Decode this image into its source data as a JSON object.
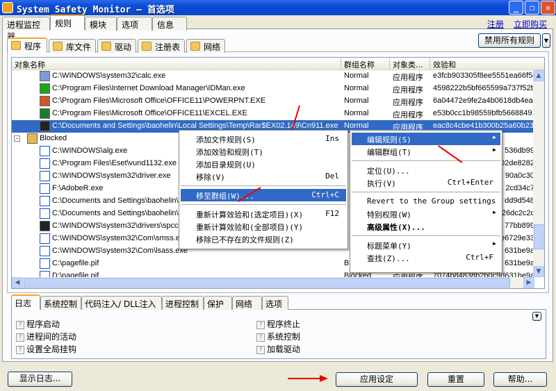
{
  "window": {
    "title": "System Safety Monitor — 首选项",
    "icon": "shield-icon",
    "controls": [
      "minimize",
      "restore",
      "close"
    ]
  },
  "main_tabs": [
    "进程监控器",
    "规则",
    "模块",
    "选项",
    "信息"
  ],
  "active_main_tab": 1,
  "links": {
    "register": "注册",
    "buy": "立即购买"
  },
  "sub_tabs": [
    {
      "label": "程序",
      "icon": "program-folder-icon"
    },
    {
      "label": "库文件",
      "icon": "library-folder-icon"
    },
    {
      "label": "驱动",
      "icon": "driver-folder-icon"
    },
    {
      "label": "注册表",
      "icon": "registry-folder-icon"
    },
    {
      "label": "网络",
      "icon": "network-icon"
    }
  ],
  "disable_all_button": "禁用所有规则",
  "columns": [
    "对象名称",
    "群组名称",
    "对象类...",
    "效验和"
  ],
  "rows": [
    {
      "name": "C:\\WINDOWS\\system32\\calc.exe",
      "group": "Normal",
      "type": "应用程序",
      "checksum": "e3fcb903305f8ee5551ea66f5c",
      "icon": "calc-icon",
      "kind": "file"
    },
    {
      "name": "C:\\Program Files\\Internet Download Manager\\IDMan.exe",
      "group": "Normal",
      "type": "应用程序",
      "checksum": "4598222b5bf665599a737f52b",
      "icon": "idm-icon",
      "kind": "file"
    },
    {
      "name": "C:\\Program Files\\Microsoft Office\\OFFICE11\\POWERPNT.EXE",
      "group": "Normal",
      "type": "应用程序",
      "checksum": "6a04472e9fe2a4b0618db4ea1",
      "icon": "powerpoint-icon",
      "kind": "file"
    },
    {
      "name": "C:\\Program Files\\Microsoft Office\\OFFICE11\\EXCEL.EXE",
      "group": "Normal",
      "type": "应用程序",
      "checksum": "e53b0cc1b98559bfb56688491",
      "icon": "excel-icon",
      "kind": "file"
    },
    {
      "name": "C:\\Documents and Settings\\baohelin\\Local Settings\\Temp\\Rar$EX02.149\\Cn911.exe",
      "group": "Normal",
      "type": "应用程序",
      "checksum": "eac8c4cbe41b300b25a60b23",
      "icon": "skull-icon",
      "kind": "file",
      "selected": true
    },
    {
      "name": "Blocked",
      "group": "",
      "type": "",
      "checksum": "",
      "icon": "group-folder-icon",
      "kind": "group"
    },
    {
      "name": "C:\\WINDOWS\\alg.exe",
      "group": "",
      "type": "",
      "checksum": "536db99",
      "icon": "window-icon",
      "kind": "file"
    },
    {
      "name": "C:\\Program Files\\Eset\\vund1132.exe",
      "group": "",
      "type": "",
      "checksum": "02de8282",
      "icon": "window-icon",
      "kind": "file"
    },
    {
      "name": "C:\\WINDOWS\\system32\\driver.exe",
      "group": "",
      "type": "",
      "checksum": "90a0c30",
      "icon": "window-icon",
      "kind": "file"
    },
    {
      "name": "F:\\AdobeR.exe",
      "group": "",
      "type": "",
      "checksum": "2cd34c7",
      "icon": "window-icon",
      "kind": "file"
    },
    {
      "name": "C:\\Documents and Settings\\baohelin\\",
      "group": "",
      "type": "",
      "checksum": "dd9d548",
      "icon": "window-icon",
      "kind": "file"
    },
    {
      "name": "C:\\Documents and Settings\\baohelin\\",
      "group": "",
      "type": "",
      "checksum": "26dc2c2c",
      "icon": "shortcut-icon",
      "kind": "file"
    },
    {
      "name": "C:\\WINDOWS\\system32\\drivers\\spcc",
      "group": "",
      "type": "",
      "checksum": "77bb899",
      "icon": "skull-icon",
      "kind": "file"
    },
    {
      "name": "C:\\WINDOWS\\system32\\Com\\smss.e",
      "group": "",
      "type": "",
      "checksum": "e6729e33",
      "icon": "window-icon",
      "kind": "file"
    },
    {
      "name": "C:\\WINDOWS\\system32\\Com\\lsass.exe",
      "group": "",
      "type": "",
      "checksum": "631be9a",
      "icon": "app-window-icon",
      "kind": "file"
    },
    {
      "name": "C:\\pagefile.pif",
      "group": "B",
      "type": "",
      "checksum": "631be9a",
      "icon": "app-window-icon",
      "kind": "file"
    },
    {
      "name": "D:\\pagefile.pif",
      "group": "Blocked",
      "type": "应用程序",
      "checksum": "7074b84838b2b0c9d631be9a",
      "icon": "app-window-icon",
      "kind": "file"
    }
  ],
  "context_menu": [
    {
      "label": "添加文件规则(S)",
      "shortcut": "Ins"
    },
    {
      "label": "添加效验和规则(T)",
      "shortcut": ""
    },
    {
      "label": "添加目录规则(U)",
      "shortcut": ""
    },
    {
      "label": "移除(V)",
      "shortcut": "Del"
    },
    {
      "sep": true
    },
    {
      "label": "移至群组(W)...",
      "shortcut": "Ctrl+C",
      "highlighted": true
    },
    {
      "sep": true
    },
    {
      "label": "重新计算效验和(选定项目)(X)",
      "shortcut": "F12"
    },
    {
      "label": "重新计算效验和(全部项目)(Y)",
      "shortcut": ""
    },
    {
      "label": "移除已不存在的文件规则(Z)",
      "shortcut": ""
    }
  ],
  "submenu": [
    {
      "label": "编辑规则(S)",
      "arrow": true,
      "highlighted": true
    },
    {
      "label": "编辑群组(T)",
      "arrow": true
    },
    {
      "sep": true
    },
    {
      "label": "定位(U)...",
      "shortcut": ""
    },
    {
      "label": "执行(V)",
      "shortcut": "Ctrl+Enter"
    },
    {
      "sep": true
    },
    {
      "label": "Revert to the Group settings"
    },
    {
      "label": "特别权限(W)",
      "arrow": true
    },
    {
      "label": "高级属性(X)...",
      "bold": true
    },
    {
      "sep": true
    },
    {
      "label": "标题菜单(Y)",
      "arrow": true
    },
    {
      "label": "查找(Z)...",
      "shortcut": "Ctrl+F"
    }
  ],
  "bottom_tabs": [
    "日志",
    "系统控制",
    "代码注入/ DLL注入",
    "进程控制",
    "保护",
    "网络",
    "选项"
  ],
  "log_options_left": [
    "程序启动",
    "进程间的活动",
    "设置全局挂钩"
  ],
  "log_options_right": [
    "程序终止",
    "系统控制",
    "加载驱动"
  ],
  "buttons": {
    "show_log": "显示日志...",
    "apply": "应用设定",
    "reset": "重置",
    "help": "帮助..."
  },
  "colors": {
    "selection": "#316ac5",
    "titlebar": "#0a4bd6",
    "annotation_arrow": "#ee0000"
  }
}
